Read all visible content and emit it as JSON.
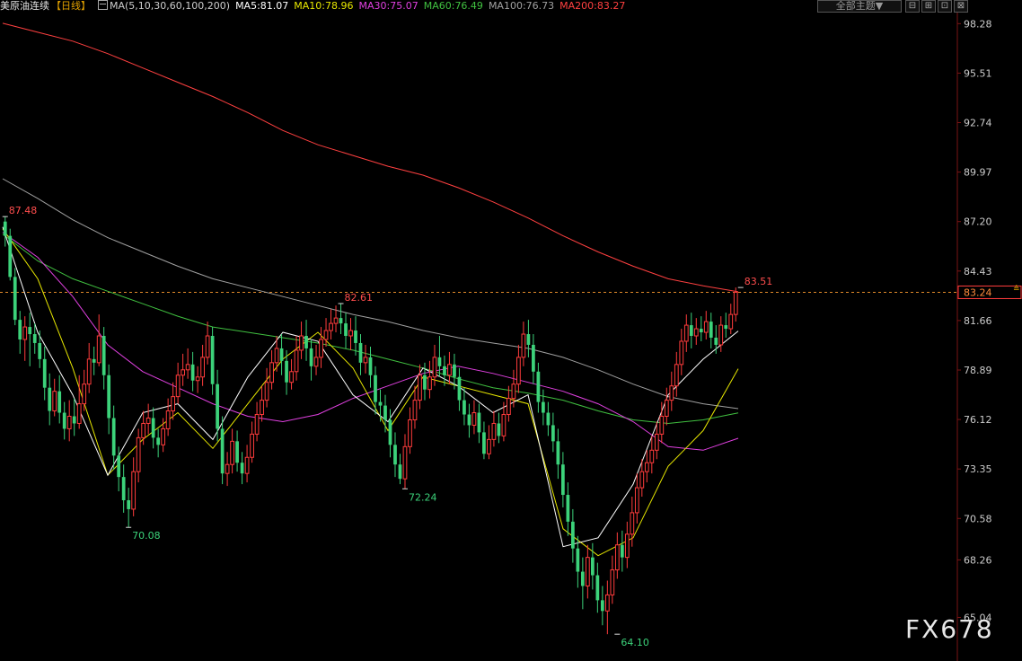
{
  "header": {
    "title": "美原油连续",
    "period": "【日线】",
    "ma_params": "MA(5,10,30,60,100,200)",
    "ma_values": [
      {
        "label": "MA5:81.07",
        "color": "#ffffff"
      },
      {
        "label": "MA10:78.96",
        "color": "#e6e600"
      },
      {
        "label": "MA30:75.07",
        "color": "#e040e0"
      },
      {
        "label": "MA60:76.49",
        "color": "#40c040"
      },
      {
        "label": "MA100:76.73",
        "color": "#a0a0a0"
      },
      {
        "label": "MA200:83.27",
        "color": "#ff4040"
      }
    ],
    "theme_button": "全部主题▼",
    "toolbar_icons": [
      "⊟",
      "⊞",
      "⊡",
      "⊠"
    ]
  },
  "logo": "FX678",
  "colors": {
    "up": "#ff3c3c",
    "down": "#3cd27a",
    "axis_text": "#cccccc",
    "ref_line": "#e08a2a"
  },
  "chart_data": {
    "type": "candlestick",
    "title": "美原油连续【日线】",
    "y_ticks": [
      "98.28",
      "95.51",
      "92.74",
      "89.97",
      "87.20",
      "84.43",
      "81.66",
      "78.89",
      "76.12",
      "73.35",
      "70.58",
      "68.26",
      "65.04"
    ],
    "y_range": [
      62.6,
      98.9
    ],
    "current_price": 83.24,
    "annotations": [
      {
        "label": "87.48",
        "value": 87.48,
        "index": 0,
        "color": "#ff4d4d"
      },
      {
        "label": "70.08",
        "value": 70.08,
        "index": 25,
        "color": "#3cd27a"
      },
      {
        "label": "82.61",
        "value": 82.61,
        "index": 68,
        "color": "#ff4d4d"
      },
      {
        "label": "72.24",
        "value": 72.24,
        "index": 81,
        "color": "#3cd27a"
      },
      {
        "label": "64.10",
        "value": 64.1,
        "index": 124,
        "color": "#3cd27a"
      },
      {
        "label": "83.51",
        "value": 83.51,
        "index": 149,
        "color": "#ff4d4d"
      }
    ],
    "series": [
      {
        "name": "MA200",
        "color": "#ff4040",
        "values": [
          98.3,
          97.8,
          97.3,
          96.6,
          95.8,
          95.0,
          94.2,
          93.3,
          92.3,
          91.5,
          90.9,
          90.3,
          89.8,
          89.1,
          88.3,
          87.4,
          86.4,
          85.5,
          84.7,
          84.0,
          83.6,
          83.27
        ]
      },
      {
        "name": "MA100",
        "color": "#a0a0a0",
        "values": [
          89.6,
          88.5,
          87.3,
          86.3,
          85.5,
          84.7,
          84.0,
          83.5,
          83.0,
          82.5,
          82.0,
          81.6,
          81.1,
          80.7,
          80.4,
          80.1,
          79.6,
          78.9,
          78.1,
          77.4,
          77.0,
          76.73
        ]
      },
      {
        "name": "MA60",
        "color": "#40c040",
        "values": [
          86.5,
          85.0,
          84.0,
          83.3,
          82.6,
          81.9,
          81.3,
          81.0,
          80.7,
          80.4,
          80.0,
          79.5,
          79.0,
          78.4,
          77.9,
          77.6,
          77.2,
          76.6,
          76.1,
          75.9,
          76.1,
          76.49
        ]
      },
      {
        "name": "MA30",
        "color": "#e040e0",
        "values": [
          86.6,
          85.2,
          83.0,
          80.3,
          78.8,
          77.9,
          77.0,
          76.3,
          76.0,
          76.4,
          77.3,
          78.0,
          78.7,
          79.1,
          78.7,
          78.2,
          77.7,
          77.0,
          76.0,
          74.6,
          74.4,
          75.07
        ]
      },
      {
        "name": "MA10",
        "color": "#e6e600",
        "values": [
          86.8,
          84.0,
          79.0,
          73.0,
          75.0,
          76.5,
          74.5,
          77.0,
          79.5,
          81.0,
          79.0,
          75.5,
          78.5,
          78.0,
          77.5,
          77.0,
          70.0,
          68.5,
          69.5,
          73.5,
          75.5,
          78.96
        ]
      },
      {
        "name": "MA5",
        "color": "#ffffff",
        "values": [
          86.9,
          81.0,
          77.5,
          73.0,
          76.5,
          77.0,
          75.0,
          78.5,
          81.0,
          80.5,
          77.5,
          76.0,
          79.0,
          78.0,
          76.5,
          77.5,
          69.0,
          69.5,
          72.5,
          77.5,
          79.5,
          81.07
        ]
      }
    ],
    "candles": [
      [
        87.2,
        86.4,
        87.48,
        85.8
      ],
      [
        86.4,
        84.1,
        86.8,
        83.9
      ],
      [
        84.1,
        81.7,
        84.6,
        81.4
      ],
      [
        81.7,
        80.6,
        82.2,
        79.8
      ],
      [
        80.6,
        81.3,
        81.9,
        79.4
      ],
      [
        81.3,
        80.9,
        82.1,
        79.1
      ],
      [
        80.9,
        80.4,
        81.5,
        79.8
      ],
      [
        80.4,
        79.5,
        81.1,
        79.0
      ],
      [
        79.5,
        77.9,
        80.2,
        77.2
      ],
      [
        77.9,
        76.6,
        78.7,
        75.8
      ],
      [
        76.6,
        77.7,
        78.4,
        76.3
      ],
      [
        77.7,
        76.5,
        78.6,
        75.9
      ],
      [
        76.5,
        75.6,
        77.1,
        75.0
      ],
      [
        75.6,
        76.3,
        77.2,
        74.9
      ],
      [
        76.3,
        75.9,
        77.3,
        75.2
      ],
      [
        75.9,
        77.0,
        78.6,
        75.6
      ],
      [
        77.0,
        78.1,
        78.9,
        76.6
      ],
      [
        78.1,
        79.5,
        80.4,
        77.6
      ],
      [
        79.5,
        79.3,
        80.2,
        78.6
      ],
      [
        79.3,
        80.8,
        82.0,
        79.1
      ],
      [
        80.8,
        78.6,
        81.3,
        77.8
      ],
      [
        78.6,
        76.2,
        79.2,
        75.3
      ],
      [
        76.2,
        74.1,
        76.9,
        73.3
      ],
      [
        74.1,
        72.9,
        74.6,
        72.1
      ],
      [
        72.9,
        71.6,
        73.6,
        70.9
      ],
      [
        71.6,
        71.1,
        72.3,
        70.08
      ],
      [
        71.1,
        73.2,
        74.0,
        70.7
      ],
      [
        73.2,
        75.1,
        75.6,
        72.6
      ],
      [
        75.1,
        75.9,
        76.6,
        74.7
      ],
      [
        75.9,
        76.2,
        77.0,
        75.3
      ],
      [
        76.2,
        75.1,
        76.8,
        74.5
      ],
      [
        75.1,
        74.7,
        75.6,
        74.0
      ],
      [
        74.7,
        75.6,
        76.2,
        74.3
      ],
      [
        75.6,
        76.6,
        77.3,
        75.2
      ],
      [
        76.6,
        77.4,
        78.2,
        76.1
      ],
      [
        77.4,
        78.6,
        79.3,
        77.0
      ],
      [
        78.6,
        78.9,
        79.8,
        78.0
      ],
      [
        78.9,
        79.2,
        80.1,
        78.4
      ],
      [
        79.2,
        78.3,
        79.9,
        77.7
      ],
      [
        78.3,
        78.5,
        79.1,
        77.6
      ],
      [
        78.5,
        79.6,
        80.3,
        78.0
      ],
      [
        79.6,
        80.8,
        81.6,
        79.2
      ],
      [
        80.8,
        78.1,
        81.3,
        77.5
      ],
      [
        78.1,
        75.6,
        78.9,
        74.9
      ],
      [
        75.6,
        73.1,
        76.3,
        72.5
      ],
      [
        73.1,
        73.6,
        74.3,
        72.4
      ],
      [
        73.6,
        74.9,
        75.6,
        73.1
      ],
      [
        74.9,
        73.7,
        75.5,
        73.2
      ],
      [
        73.7,
        73.1,
        74.3,
        72.5
      ],
      [
        73.1,
        74.0,
        74.7,
        72.6
      ],
      [
        74.0,
        75.3,
        76.0,
        73.7
      ],
      [
        75.3,
        76.4,
        77.1,
        74.9
      ],
      [
        76.4,
        77.2,
        78.0,
        76.0
      ],
      [
        77.2,
        78.2,
        79.0,
        76.8
      ],
      [
        78.2,
        79.3,
        80.0,
        77.8
      ],
      [
        79.3,
        80.1,
        80.8,
        78.8
      ],
      [
        80.1,
        79.4,
        80.9,
        78.6
      ],
      [
        79.4,
        78.2,
        80.0,
        77.5
      ],
      [
        78.2,
        78.8,
        79.5,
        77.8
      ],
      [
        78.8,
        80.0,
        80.8,
        78.3
      ],
      [
        80.0,
        80.8,
        81.6,
        79.5
      ],
      [
        80.8,
        80.1,
        81.7,
        79.4
      ],
      [
        80.1,
        79.1,
        80.6,
        78.3
      ],
      [
        79.1,
        79.6,
        80.3,
        78.6
      ],
      [
        79.6,
        80.6,
        81.3,
        79.0
      ],
      [
        80.6,
        81.1,
        81.8,
        80.2
      ],
      [
        81.1,
        81.5,
        82.3,
        80.6
      ],
      [
        81.5,
        81.8,
        82.5,
        81.0
      ],
      [
        81.8,
        81.5,
        82.61,
        80.9
      ],
      [
        81.5,
        80.8,
        82.1,
        80.1
      ],
      [
        80.8,
        81.1,
        81.8,
        80.0
      ],
      [
        81.1,
        80.4,
        81.9,
        79.7
      ],
      [
        80.4,
        79.3,
        80.9,
        78.6
      ],
      [
        79.3,
        79.6,
        80.3,
        78.7
      ],
      [
        79.6,
        78.6,
        80.2,
        77.9
      ],
      [
        78.6,
        77.1,
        79.1,
        76.4
      ],
      [
        77.1,
        76.9,
        77.8,
        76.0
      ],
      [
        76.9,
        76.1,
        77.5,
        75.4
      ],
      [
        76.1,
        74.7,
        76.7,
        74.0
      ],
      [
        74.7,
        73.6,
        75.4,
        72.9
      ],
      [
        73.6,
        72.8,
        74.2,
        72.5
      ],
      [
        72.8,
        74.6,
        75.3,
        72.24
      ],
      [
        74.6,
        76.1,
        76.8,
        74.2
      ],
      [
        76.1,
        77.2,
        78.0,
        75.6
      ],
      [
        77.2,
        78.6,
        79.2,
        76.7
      ],
      [
        78.6,
        77.8,
        79.3,
        77.2
      ],
      [
        77.8,
        78.5,
        79.4,
        77.3
      ],
      [
        78.5,
        79.6,
        80.3,
        78.0
      ],
      [
        79.6,
        79.1,
        80.8,
        78.5
      ],
      [
        79.1,
        78.6,
        79.7,
        78.0
      ],
      [
        78.6,
        79.2,
        79.9,
        78.1
      ],
      [
        79.2,
        78.5,
        79.8,
        77.8
      ],
      [
        78.5,
        77.2,
        79.0,
        76.6
      ],
      [
        77.2,
        76.4,
        77.9,
        75.8
      ],
      [
        76.4,
        75.8,
        77.0,
        75.1
      ],
      [
        75.8,
        76.5,
        77.2,
        75.3
      ],
      [
        76.5,
        75.4,
        77.0,
        74.8
      ],
      [
        75.4,
        74.2,
        76.0,
        73.9
      ],
      [
        74.2,
        75.0,
        75.8,
        73.9
      ],
      [
        75.0,
        75.9,
        76.6,
        74.6
      ],
      [
        75.9,
        75.2,
        76.5,
        74.8
      ],
      [
        75.2,
        76.4,
        77.1,
        74.9
      ],
      [
        76.4,
        77.3,
        78.0,
        76.0
      ],
      [
        77.3,
        78.1,
        78.9,
        76.8
      ],
      [
        78.1,
        79.6,
        80.3,
        77.6
      ],
      [
        79.6,
        80.9,
        81.6,
        79.1
      ],
      [
        80.9,
        80.3,
        81.7,
        79.6
      ],
      [
        80.3,
        78.8,
        80.9,
        78.1
      ],
      [
        78.8,
        77.1,
        79.3,
        76.5
      ],
      [
        77.1,
        76.5,
        77.8,
        75.8
      ],
      [
        76.5,
        75.8,
        77.1,
        75.2
      ],
      [
        75.8,
        74.9,
        76.5,
        74.3
      ],
      [
        74.9,
        73.6,
        75.6,
        72.8
      ],
      [
        73.6,
        71.9,
        74.3,
        71.2
      ],
      [
        71.9,
        70.4,
        72.6,
        69.6
      ],
      [
        70.4,
        68.9,
        71.1,
        68.1
      ],
      [
        68.9,
        67.6,
        69.6,
        66.7
      ],
      [
        67.6,
        66.8,
        68.4,
        65.5
      ],
      [
        66.8,
        68.4,
        69.1,
        66.1
      ],
      [
        68.4,
        67.4,
        69.2,
        66.6
      ],
      [
        67.4,
        66.0,
        68.1,
        65.3
      ],
      [
        66.0,
        65.4,
        66.8,
        64.6
      ],
      [
        65.4,
        66.3,
        67.1,
        64.1
      ],
      [
        66.3,
        67.7,
        68.5,
        65.8
      ],
      [
        67.7,
        69.1,
        69.8,
        67.2
      ],
      [
        69.1,
        68.4,
        69.9,
        67.6
      ],
      [
        68.4,
        69.7,
        70.4,
        67.8
      ],
      [
        69.7,
        70.9,
        71.8,
        69.0
      ],
      [
        70.9,
        72.3,
        73.1,
        70.3
      ],
      [
        72.3,
        73.2,
        73.9,
        71.8
      ],
      [
        73.2,
        73.7,
        74.4,
        72.6
      ],
      [
        73.7,
        74.4,
        75.2,
        73.1
      ],
      [
        74.4,
        75.3,
        76.0,
        73.9
      ],
      [
        75.3,
        76.3,
        77.1,
        74.8
      ],
      [
        76.3,
        77.2,
        77.9,
        75.8
      ],
      [
        77.2,
        78.0,
        78.8,
        76.6
      ],
      [
        78.0,
        79.2,
        79.9,
        77.4
      ],
      [
        79.2,
        80.5,
        81.2,
        78.6
      ],
      [
        80.5,
        81.4,
        82.0,
        79.9
      ],
      [
        81.4,
        80.8,
        82.1,
        80.1
      ],
      [
        80.8,
        81.2,
        81.8,
        80.3
      ],
      [
        81.2,
        81.0,
        81.9,
        80.5
      ],
      [
        81.0,
        81.6,
        82.2,
        80.6
      ],
      [
        81.6,
        80.7,
        82.1,
        80.1
      ],
      [
        80.7,
        80.3,
        81.4,
        79.8
      ],
      [
        80.3,
        81.4,
        81.9,
        79.9
      ],
      [
        81.4,
        81.2,
        82.1,
        80.7
      ],
      [
        81.2,
        82.0,
        82.6,
        80.9
      ],
      [
        82.0,
        83.24,
        83.51,
        81.6
      ]
    ]
  }
}
